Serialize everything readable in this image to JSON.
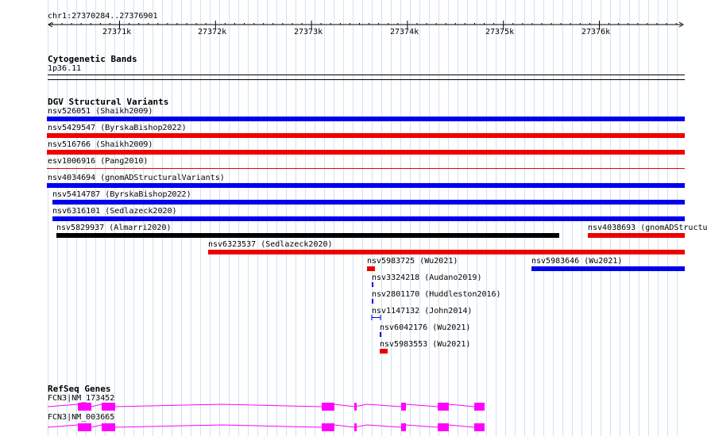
{
  "ruler": {
    "region": "chr1:27370284..27376901",
    "ticks": [
      "27371k",
      "27372k",
      "27373k",
      "27374k",
      "27375k",
      "27376k"
    ]
  },
  "cytoband": {
    "title": "Cytogenetic Bands",
    "band": "1p36.11"
  },
  "dgv": {
    "title": "DGV Structural Variants",
    "colors": {
      "gain": "#0000ee",
      "loss": "#ee0000",
      "complex": "#000000"
    },
    "features": [
      {
        "label": "nsv526051  (Shaikh2009)",
        "color": "blue"
      },
      {
        "label": "nsv5429547  (ByrskaBishop2022)",
        "color": "red"
      },
      {
        "label": "nsv516766  (Shaikh2009)",
        "color": "red"
      },
      {
        "label": "esv1006916  (Pang2010)",
        "color": "red"
      },
      {
        "label": "nsv4034694  (gnomADStructuralVariants)",
        "color": "blue"
      },
      {
        "label": "nsv5414787  (ByrskaBishop2022)",
        "color": "blue"
      },
      {
        "label": "nsv6316101  (Sedlazeck2020)",
        "color": "blue"
      },
      {
        "label": "nsv5829937  (Almarri2020)",
        "color": "black"
      },
      {
        "label": "nsv4038693  (gnomADStructu",
        "color": "red"
      },
      {
        "label": "nsv6323537  (Sedlazeck2020)",
        "color": "red"
      },
      {
        "label": "nsv5983725  (Wu2021)",
        "color": "red"
      },
      {
        "label": "nsv5983646  (Wu2021)",
        "color": "blue"
      },
      {
        "label": "nsv3324218  (Audano2019)",
        "color": "blue"
      },
      {
        "label": "nsv2801170  (Huddleston2016)",
        "color": "blue"
      },
      {
        "label": "nsv1147132  (John2014)",
        "color": "blue"
      },
      {
        "label": "nsv6042176  (Wu2021)",
        "color": "blue"
      },
      {
        "label": "nsv5983553  (Wu2021)",
        "color": "red"
      }
    ]
  },
  "refseq": {
    "title": "RefSeq Genes",
    "exon_color": "#ff00ff",
    "transcripts": [
      {
        "label": "FCN3|NM_173452"
      },
      {
        "label": "FCN3|NM_003665"
      }
    ]
  }
}
